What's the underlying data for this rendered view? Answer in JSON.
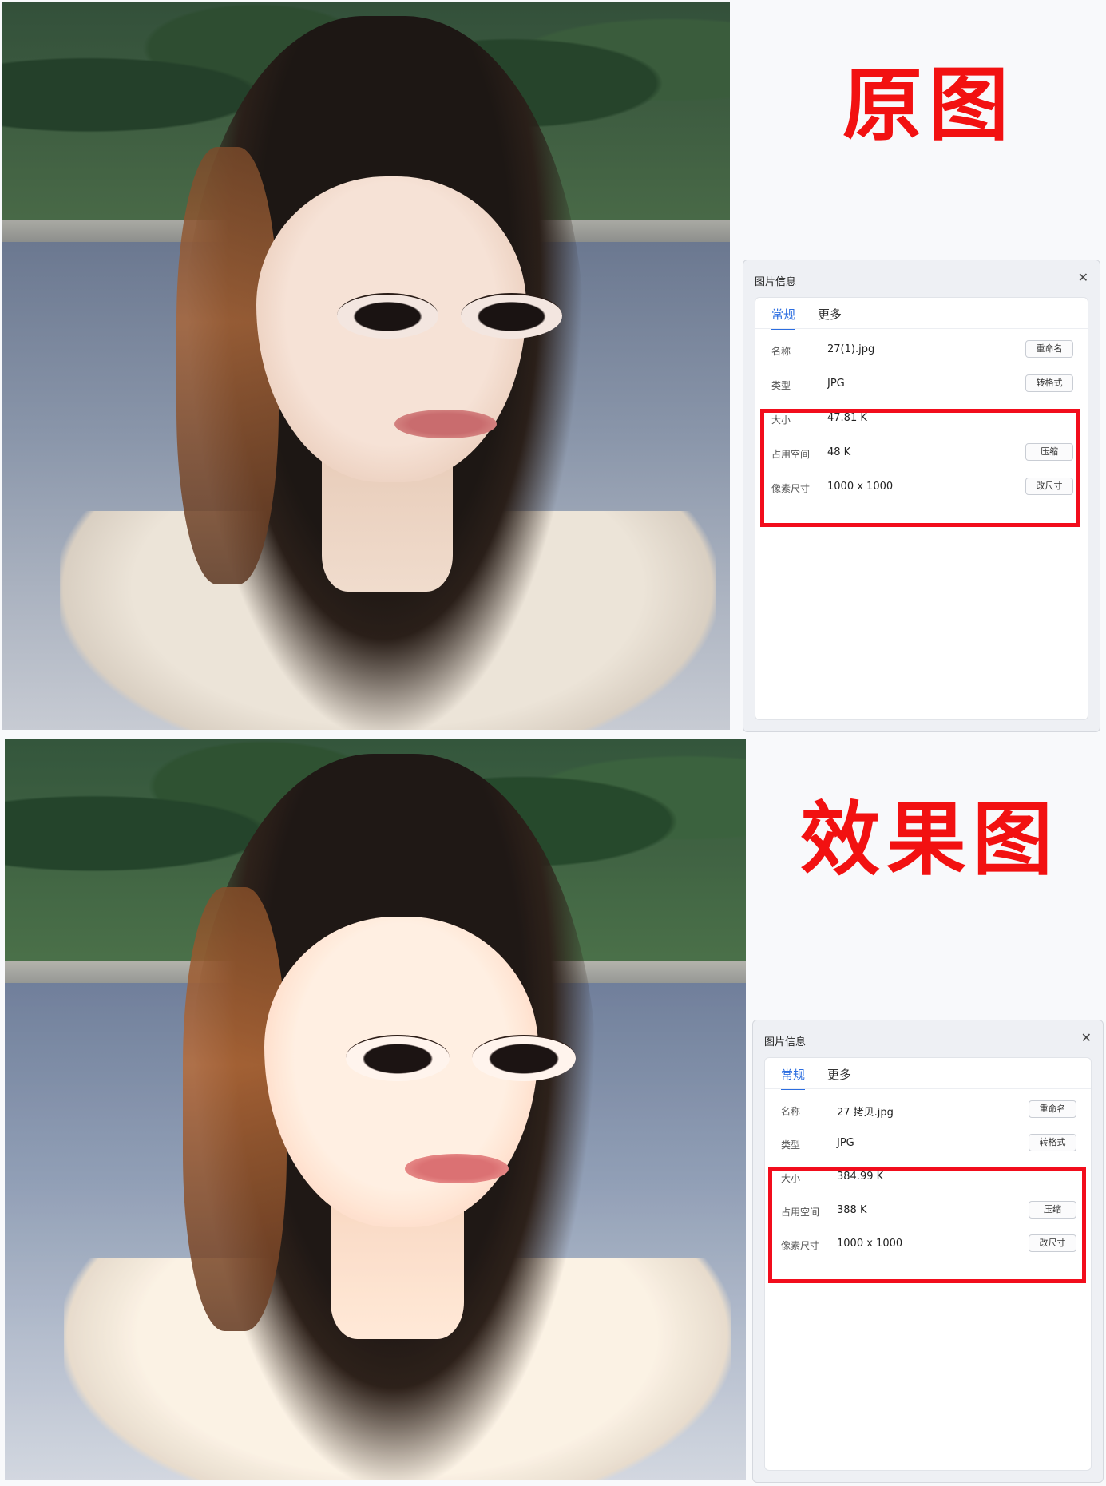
{
  "top": {
    "title": "原图",
    "panel": {
      "heading": "图片信息",
      "close_glyph": "✕",
      "tabs": [
        "常规",
        "更多"
      ],
      "rows": [
        {
          "label": "名称",
          "value": "27(1).jpg",
          "button": "重命名"
        },
        {
          "label": "类型",
          "value": "JPG",
          "button": "转格式"
        },
        {
          "label": "大小",
          "value": "47.81 K",
          "button": ""
        },
        {
          "label": "占用空间",
          "value": "48 K",
          "button": "压缩"
        },
        {
          "label": "像素尺寸",
          "value": "1000 x 1000",
          "button": "改尺寸"
        }
      ]
    }
  },
  "bottom": {
    "title": "效果图",
    "panel": {
      "heading": "图片信息",
      "close_glyph": "✕",
      "tabs": [
        "常规",
        "更多"
      ],
      "rows": [
        {
          "label": "名称",
          "value": "27 拷贝.jpg",
          "button": "重命名"
        },
        {
          "label": "类型",
          "value": "JPG",
          "button": "转格式"
        },
        {
          "label": "大小",
          "value": "384.99 K",
          "button": ""
        },
        {
          "label": "占用空间",
          "value": "388 K",
          "button": "压缩"
        },
        {
          "label": "像素尺寸",
          "value": "1000 x 1000",
          "button": "改尺寸"
        }
      ]
    }
  },
  "colors": {
    "title_red": "#f21111",
    "highlight_red": "#f20d1c",
    "tab_blue": "#2b6de0"
  }
}
